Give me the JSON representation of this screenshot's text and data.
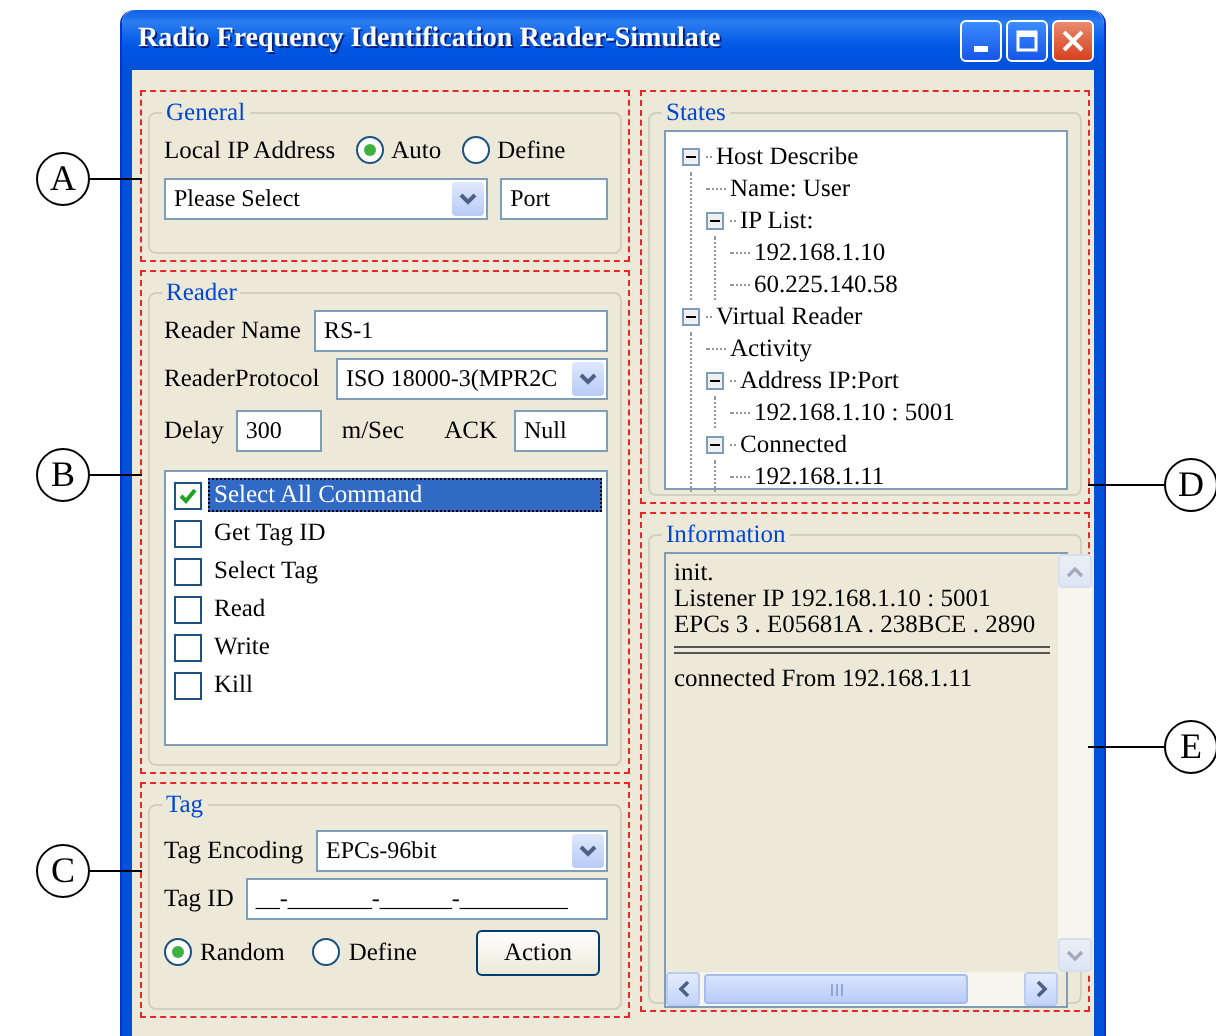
{
  "window": {
    "title": "Radio Frequency Identification Reader-Simulate"
  },
  "general": {
    "callout": "A",
    "title": "General",
    "ip_label": "Local IP Address",
    "ip_modes": [
      {
        "label": "Auto",
        "selected": true
      },
      {
        "label": "Define",
        "selected": false
      }
    ],
    "ip_select": {
      "value": "Please Select"
    },
    "port": {
      "value": "Port"
    }
  },
  "reader": {
    "callout": "B",
    "title": "Reader",
    "name_label": "Reader Name",
    "name_value": "RS-1",
    "protocol_label": "ReaderProtocol",
    "protocol_value": "ISO 18000-3(MPR2C",
    "delay_label": "Delay",
    "delay_value": "300",
    "delay_unit": "m/Sec",
    "ack_label": "ACK",
    "ack_value": "Null",
    "commands": [
      {
        "label": "Select All Command",
        "checked": true,
        "selected": true
      },
      {
        "label": "Get Tag ID",
        "checked": false,
        "selected": false
      },
      {
        "label": "Select Tag",
        "checked": false,
        "selected": false
      },
      {
        "label": "Read",
        "checked": false,
        "selected": false
      },
      {
        "label": "Write",
        "checked": false,
        "selected": false
      },
      {
        "label": "Kill",
        "checked": false,
        "selected": false
      }
    ]
  },
  "tag": {
    "callout": "C",
    "title": "Tag",
    "encoding_label": "Tag Encoding",
    "encoding_value": "EPCs-96bit",
    "id_label": "Tag ID",
    "id_value": "__-_______-______-_________",
    "modes": [
      {
        "label": "Random",
        "selected": true
      },
      {
        "label": "Define",
        "selected": false
      }
    ],
    "action": "Action"
  },
  "states": {
    "callout": "D",
    "title": "States",
    "tree": [
      {
        "label": "Host Describe",
        "expanded": true,
        "children": [
          {
            "label": "Name: User"
          },
          {
            "label": "IP List:",
            "expanded": true,
            "children": [
              {
                "label": "192.168.1.10"
              },
              {
                "label": "60.225.140.58"
              }
            ]
          }
        ]
      },
      {
        "label": "Virtual Reader",
        "expanded": true,
        "children": [
          {
            "label": "Activity"
          },
          {
            "label": "Address IP:Port",
            "expanded": true,
            "children": [
              {
                "label": "192.168.1.10 : 5001"
              }
            ]
          },
          {
            "label": "Connected",
            "expanded": true,
            "children": [
              {
                "label": "192.168.1.11"
              }
            ]
          }
        ]
      }
    ]
  },
  "information": {
    "callout": "E",
    "title": "Information",
    "lines": [
      {
        "kind": "text",
        "text": "init."
      },
      {
        "kind": "text",
        "text": "Listener IP 192.168.1.10 : 5001"
      },
      {
        "kind": "text",
        "text": "EPCs 3 . E05681A . 238BCE . 2890"
      },
      {
        "kind": "rule"
      },
      {
        "kind": "text",
        "text": "connected From 192.168.1.11"
      }
    ]
  }
}
